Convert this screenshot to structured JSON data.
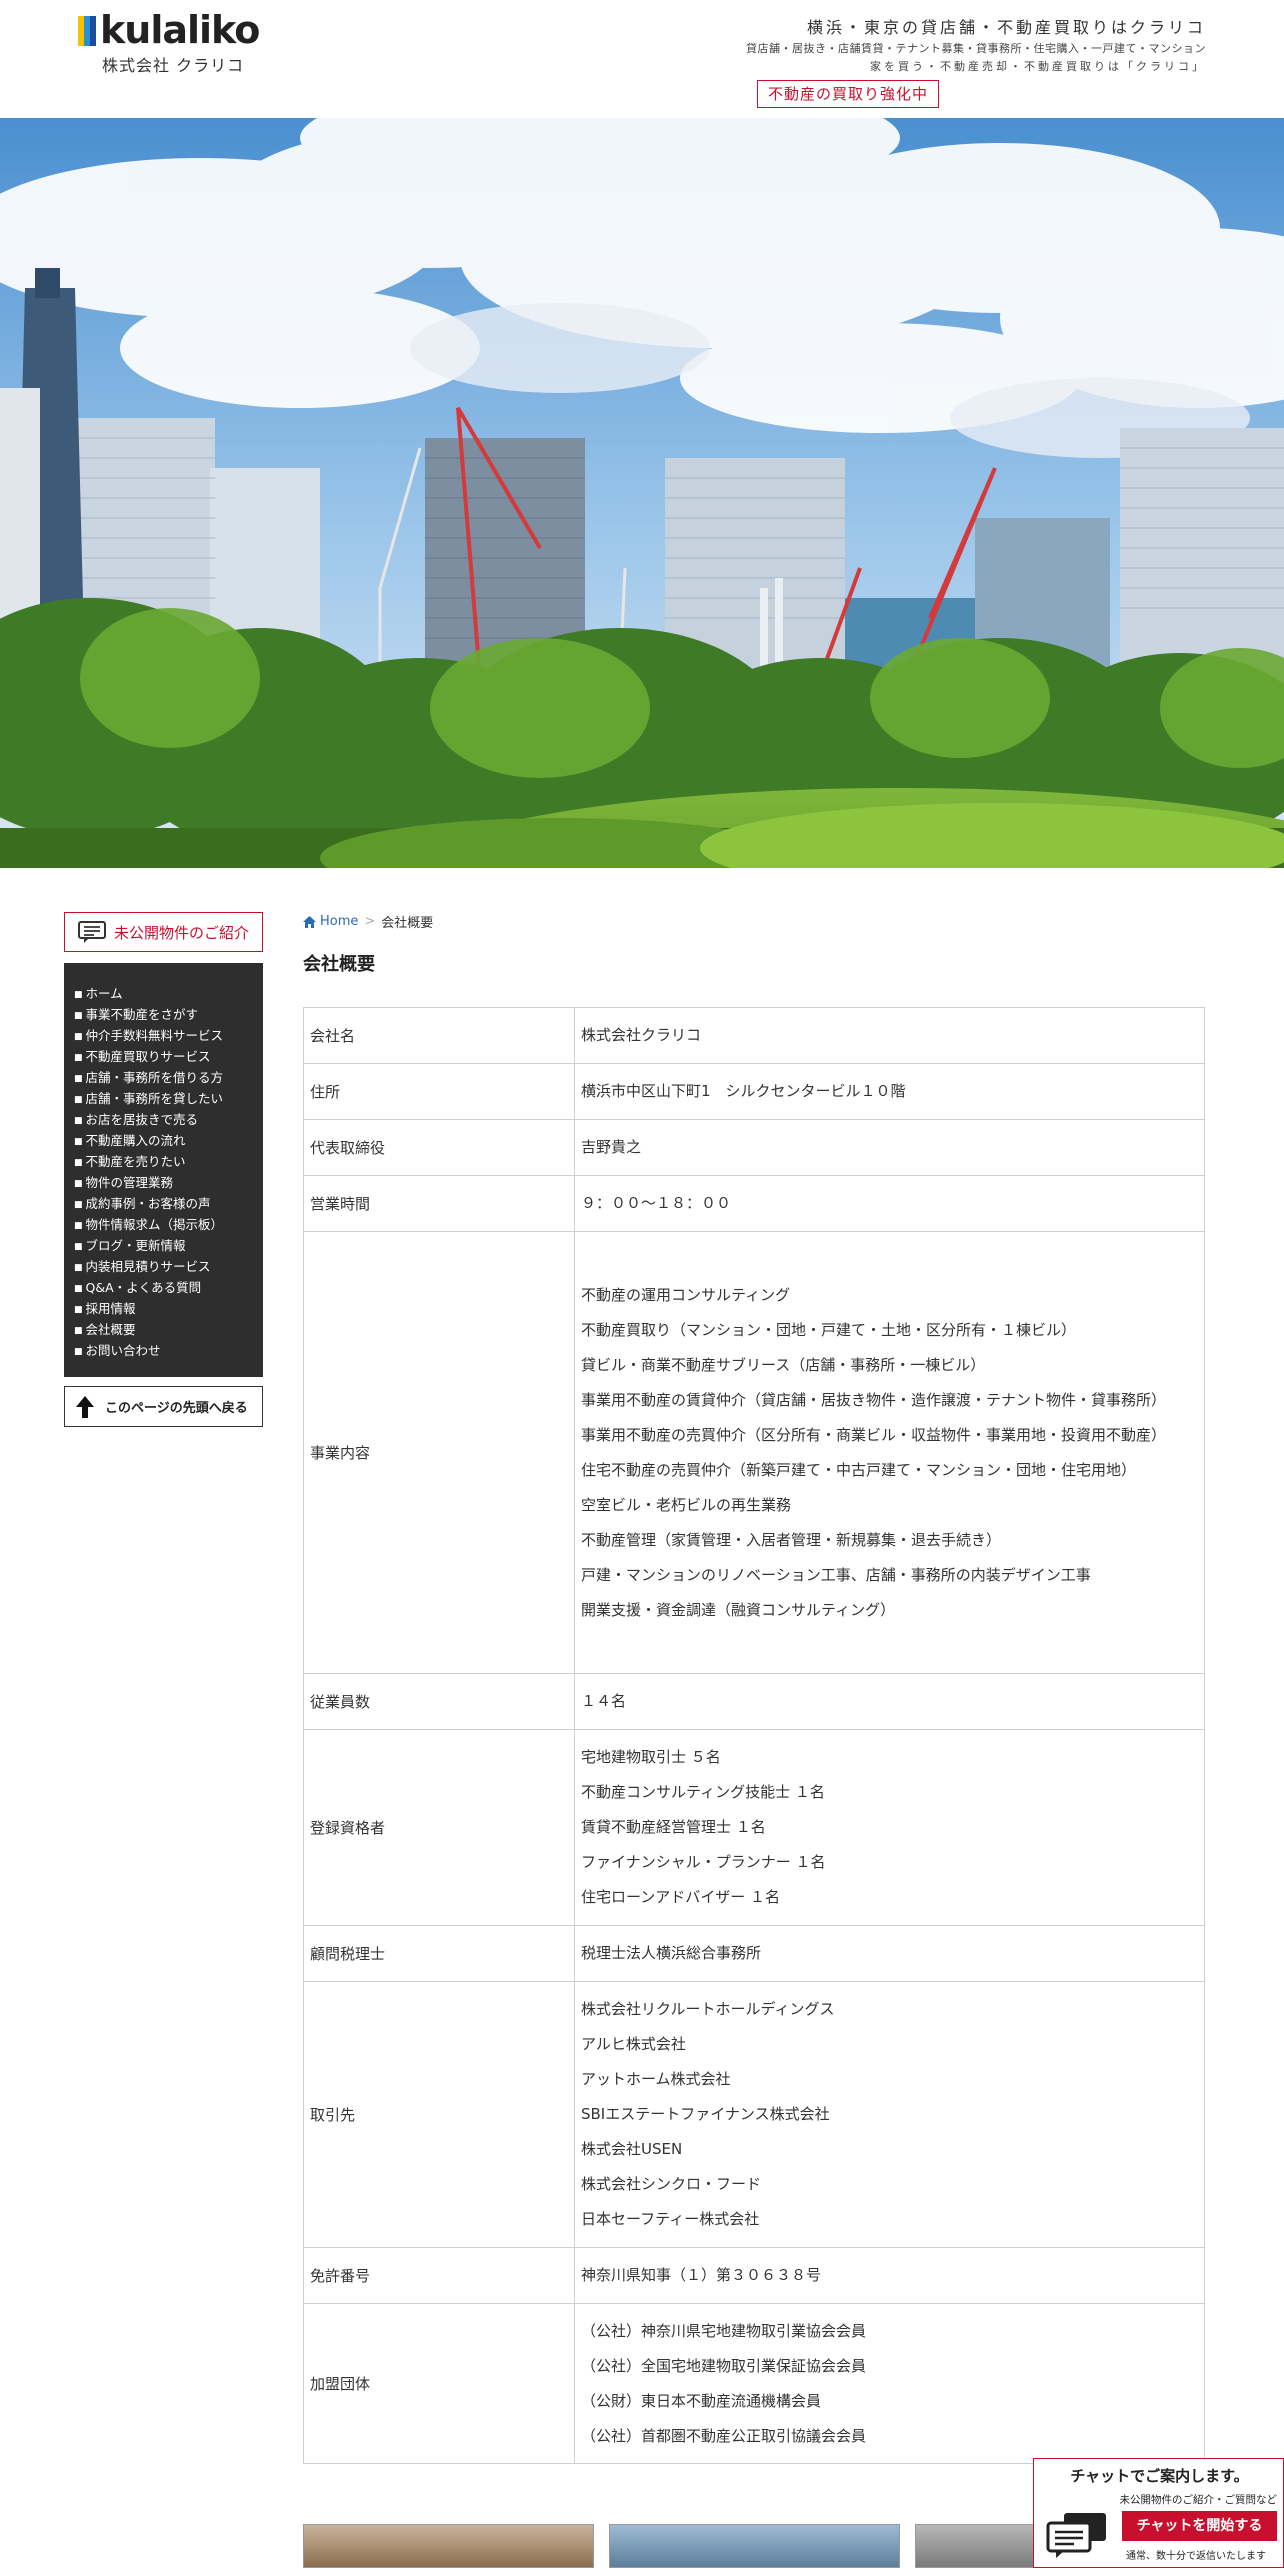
{
  "header": {
    "logo_text": "kulaliko",
    "logo_sub": "株式会社 クラリコ",
    "tagline_main": "横浜・東京の貸店舗・不動産買取りはクラリコ",
    "tagline_sub1": "貸店舗・居抜き・店舗賃貸・テナント募集・貸事務所・住宅購入・一戸建て・マンション",
    "tagline_sub2": "家を買う・不動産売却・不動産買取りは「クラリコ」",
    "badge": "不動産の買取り強化中",
    "logo_colors": [
      "#f2c500",
      "#2a8fd6",
      "#1a4e9a"
    ]
  },
  "hero": {
    "icon": "city-skyline-photo"
  },
  "sidebar": {
    "unpublished_label": "未公開物件のご紹介",
    "menu": [
      "ホーム",
      "事業不動産をさがす",
      "仲介手数料無料サービス",
      "不動産買取りサービス",
      "店舗・事務所を借りる方",
      "店舗・事務所を貸したい",
      "お店を居抜きで売る",
      "不動産購入の流れ",
      "不動産を売りたい",
      "物件の管理業務",
      "成約事例・お客様の声",
      "物件情報求ム（掲示板）",
      "ブログ・更新情報",
      "内装相見積りサービス",
      "Q&A・よくある質問",
      "採用情報",
      "会社概要",
      "お問い合わせ"
    ],
    "back_to_top": "このページの先頭へ戻る"
  },
  "breadcrumb": {
    "home": "Home",
    "separator": ">",
    "current": "会社概要"
  },
  "page_title": "会社概要",
  "company": {
    "rows": [
      {
        "label": "会社名",
        "values": [
          "株式会社クラリコ"
        ]
      },
      {
        "label": "住所",
        "values": [
          "横浜市中区山下町1　シルクセンタービル１０階"
        ]
      },
      {
        "label": "代表取締役",
        "values": [
          "吉野貴之"
        ]
      },
      {
        "label": "営業時間",
        "values": [
          "９：００〜１８：００"
        ]
      },
      {
        "label": "事業内容",
        "values": [
          "不動産の運用コンサルティング",
          "不動産買取り（マンション・団地・戸建て・土地・区分所有・１棟ビル）",
          "貸ビル・商業不動産サブリース（店舗・事務所・一棟ビル）",
          "事業用不動産の賃貸仲介（貸店舗・居抜き物件・造作譲渡・テナント物件・貸事務所）",
          "事業用不動産の売買仲介（区分所有・商業ビル・収益物件・事業用地・投資用不動産）",
          "住宅不動産の売買仲介（新築戸建て・中古戸建て・マンション・団地・住宅用地）",
          "空室ビル・老朽ビルの再生業務",
          "不動産管理（家賃管理・入居者管理・新規募集・退去手続き）",
          "戸建・マンションのリノベーション工事、店舗・事務所の内装デザイン工事",
          "開業支援・資金調達（融資コンサルティング）"
        ]
      },
      {
        "label": "従業員数",
        "values": [
          "１４名"
        ]
      },
      {
        "label": "登録資格者",
        "values": [
          "宅地建物取引士 ５名",
          "不動産コンサルティング技能士 １名",
          "賃貸不動産経営管理士 １名",
          "ファイナンシャル・プランナー １名",
          "住宅ローンアドバイザー １名"
        ]
      },
      {
        "label": "顧問税理士",
        "values": [
          "税理士法人横浜総合事務所"
        ]
      },
      {
        "label": "取引先",
        "values": [
          "株式会社リクルートホールディングス",
          "アルヒ株式会社",
          "アットホーム株式会社",
          "SBIエステートファイナンス株式会社",
          "株式会社USEN",
          "株式会社シンクロ・フード",
          "日本セーフティー株式会社"
        ]
      },
      {
        "label": "免許番号",
        "values": [
          "神奈川県知事（１）第３０６３８号"
        ]
      },
      {
        "label": "加盟団体",
        "values": [
          "（公社）神奈川県宅地建物取引業協会会員",
          "（公社）全国宅地建物取引業保証協会会員",
          "（公財）東日本不動産流通機構会員",
          "（公社）首都圏不動産公正取引協議会会員"
        ]
      }
    ]
  },
  "chat": {
    "title": "チャットでご案内します。",
    "subtitle": "未公開物件のご紹介・ご質問など",
    "button": "チャットを開始する",
    "note": "通常、数十分で返信いたします"
  }
}
